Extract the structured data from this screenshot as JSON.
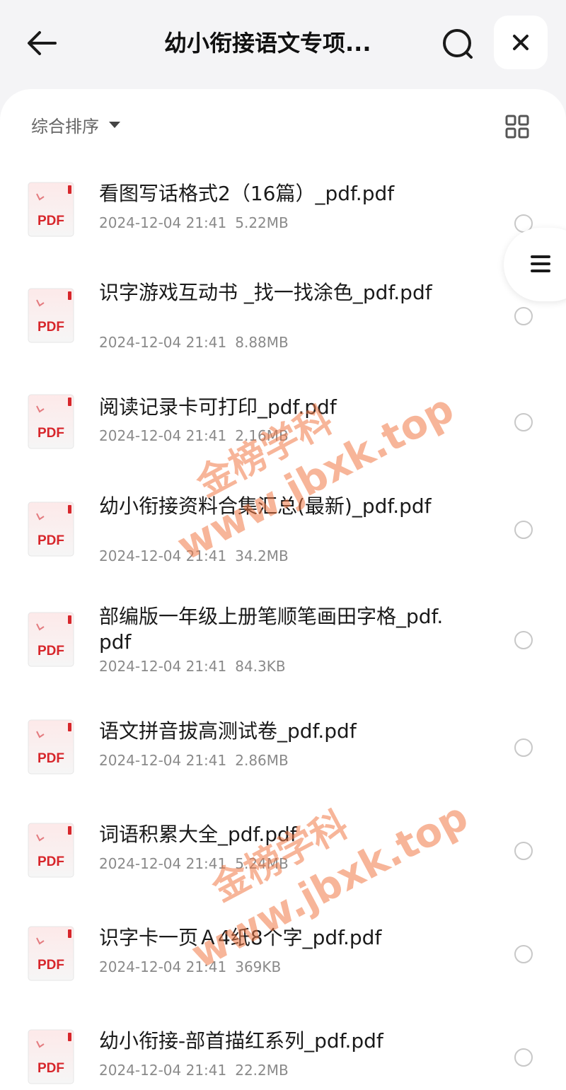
{
  "header": {
    "title": "幼小衔接语文专项...",
    "back_icon": "arrow-left-icon",
    "search_icon": "search-icon",
    "close_icon": "close-icon"
  },
  "toolbar": {
    "sort_label": "综合排序",
    "sort_icon": "caret-down-icon",
    "view_icon": "grid-view-icon"
  },
  "side_handle": {
    "icon": "menu-icon"
  },
  "file_badge": "PDF",
  "files": [
    {
      "name": "看图写话格式2（16篇）_pdf.pdf",
      "date": "2024-12-04 21:41",
      "size": "5.22MB"
    },
    {
      "name": "识字游戏互动书 _找一找涂色_pdf.pdf",
      "date": "2024-12-04 21:41",
      "size": "8.88MB"
    },
    {
      "name": "阅读记录卡可打印_pdf.pdf",
      "date": "2024-12-04 21:41",
      "size": "2.16MB"
    },
    {
      "name": "幼小衔接资料合集汇总(最新)_pdf.pdf",
      "date": "2024-12-04 21:41",
      "size": "34.2MB"
    },
    {
      "name": "部编版一年级上册笔顺笔画田字格_pdf.pdf",
      "date": "2024-12-04 21:41",
      "size": "84.3KB"
    },
    {
      "name": "语文拼音拔高测试卷_pdf.pdf",
      "date": "2024-12-04 21:41",
      "size": "2.86MB"
    },
    {
      "name": "词语积累大全_pdf.pdf",
      "date": "2024-12-04 21:41",
      "size": "5.24MB"
    },
    {
      "name": "识字卡一页Ａ4纸8个字_pdf.pdf",
      "date": "2024-12-04 21:41",
      "size": "369KB"
    },
    {
      "name": "幼小衔接-部首描红系列_pdf.pdf",
      "date": "2024-12-04 21:41",
      "size": "22.2MB"
    }
  ],
  "watermarks": [
    {
      "line1": "金榜学科",
      "line2": "www.jbxk.top"
    },
    {
      "line1": "金榜学科",
      "line2": "www.jbxk.top"
    }
  ],
  "colors": {
    "background": "#f4f4f6",
    "panel": "#ffffff",
    "pdf_red": "#d7262b",
    "watermark": "#f07846"
  }
}
